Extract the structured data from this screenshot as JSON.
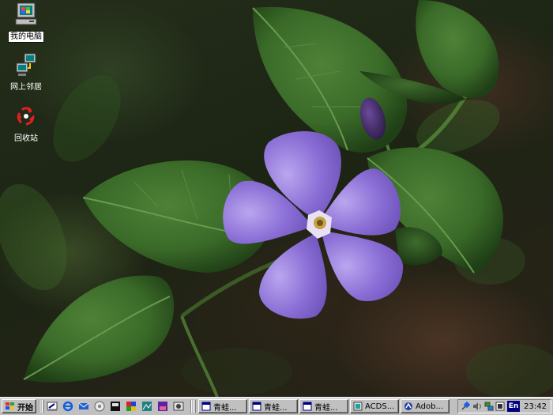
{
  "desktop": {
    "icons": [
      {
        "label": "我的电脑",
        "icon": "my-computer-icon"
      },
      {
        "label": "网上邻居",
        "icon": "network-neighborhood-icon"
      },
      {
        "label": "回收站",
        "icon": "recycle-bin-icon"
      }
    ],
    "wallpaper": "periwinkle-flower-photo"
  },
  "taskbar": {
    "start_label": "开始",
    "quick_launch": [
      "show-desktop-icon",
      "internet-explorer-icon",
      "outlook-express-icon",
      "media-player-icon",
      "app-icon-1",
      "app-icon-2",
      "app-icon-3",
      "app-icon-4",
      "app-icon-5"
    ],
    "tasks": [
      {
        "label": "青蛙...",
        "icon": "window-icon"
      },
      {
        "label": "青蛙...",
        "icon": "window-icon"
      },
      {
        "label": "青蛙...",
        "icon": "window-icon"
      },
      {
        "label": "ACDS...",
        "icon": "acdsee-icon"
      },
      {
        "label": "Adob...",
        "icon": "adobe-icon"
      }
    ],
    "tray": {
      "icons": [
        "satellite-icon",
        "speaker-icon",
        "network-icon"
      ],
      "language": "En",
      "clock": "23:42"
    }
  },
  "colors": {
    "taskbar": "#c0c0c0",
    "flower": "#8a6fd0",
    "leaf": "#3e6a2c"
  }
}
